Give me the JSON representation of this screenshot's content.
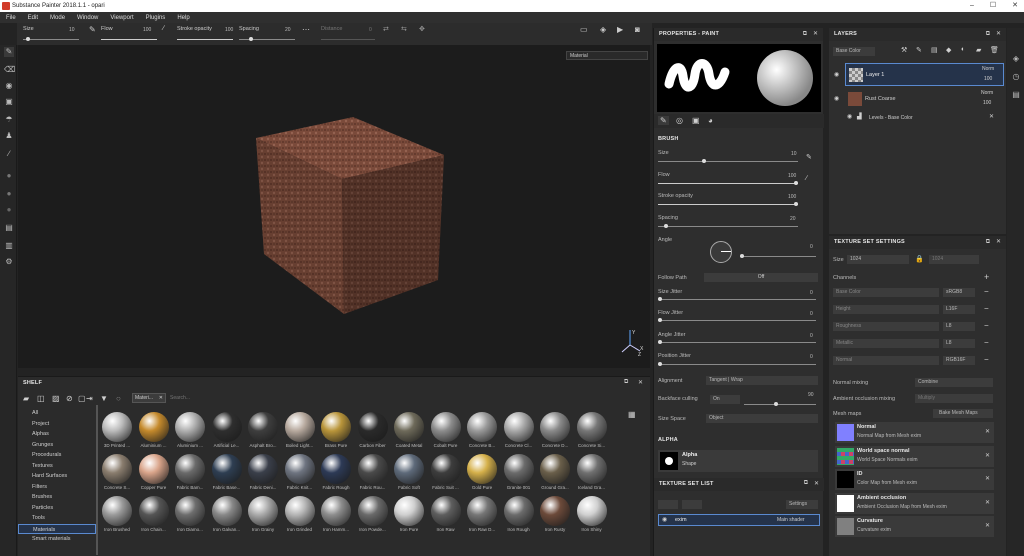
{
  "window": {
    "title": "Substance Painter 2018.1.1 - opari",
    "min": "–",
    "max": "☐",
    "close": "✕"
  },
  "menu": [
    "File",
    "Edit",
    "Mode",
    "Window",
    "Viewport",
    "Plugins",
    "Help"
  ],
  "toolbar": {
    "size_label": "Size",
    "size_val": "10",
    "flow_label": "Flow",
    "flow_val": "100",
    "stroke_label": "Stroke opacity",
    "stroke_val": "100",
    "spacing_label": "Spacing",
    "spacing_val": "20",
    "distance_label": "Distance",
    "distance_val": "0"
  },
  "viewport": {
    "mode_select": "Material",
    "axis_y": "Y",
    "axis_x": "X",
    "axis_z": "Z"
  },
  "shelf": {
    "title": "SHELF",
    "filter_chip": "Materi...",
    "search_placeholder": "Search...",
    "categories": [
      "All",
      "Project",
      "Alphas",
      "Grunges",
      "Procedurals",
      "Textures",
      "Hard Surfaces",
      "Filters",
      "Brushes",
      "Particles",
      "Tools",
      "Materials",
      "Smart materials"
    ],
    "selected_category": "Materials",
    "items_row1": [
      "3D Printed ...",
      "Aluminium ...",
      "Aluminium ...",
      "Artificial Le...",
      "Asphalt Bro...",
      "Boiled Light...",
      "Brass Pure",
      "Carbon Fiber",
      "Coated Metal",
      "Cobalt Pure",
      "Concrete B...",
      "Concrete Cl...",
      "Concrete D...",
      "Concrete Si..."
    ],
    "items_row2": [
      "Concrete S...",
      "Copper Pure",
      "Fabric Bam...",
      "Fabric Base...",
      "Fabric Deni...",
      "Fabric Knit...",
      "Fabric Rough",
      "Fabric Rou...",
      "Fabric Soft",
      "Fabric Suit ...",
      "Gold Pure",
      "Granite 001",
      "Ground Gra...",
      "Iceland Gra..."
    ],
    "items_row3": [
      "Iron Brushed",
      "Iron Chain...",
      "Iron Diamo...",
      "Iron Galvan...",
      "Iron Grainy",
      "Iron Grinded",
      "Iron Hamm...",
      "Iron Powde...",
      "Iron Pure",
      "Iron Raw",
      "Iron Raw D...",
      "Iron Rough",
      "Iron Rusty",
      "Iron Shiny"
    ]
  },
  "properties": {
    "title": "PROPERTIES - PAINT",
    "brush_header": "BRUSH",
    "size_label": "Size",
    "size_val": "10",
    "flow_label": "Flow",
    "flow_val": "100",
    "stroke_label": "Stroke opacity",
    "stroke_val": "100",
    "spacing_label": "Spacing",
    "spacing_val": "20",
    "angle_label": "Angle",
    "angle_val": "0",
    "follow_label": "Follow Path",
    "follow_val": "Off",
    "sizej_label": "Size Jitter",
    "sizej_val": "0",
    "flowj_label": "Flow Jitter",
    "flowj_val": "0",
    "anglej_label": "Angle Jitter",
    "anglej_val": "0",
    "posj_label": "Position Jitter",
    "posj_val": "0",
    "align_label": "Alignment",
    "align_val": "Tangent | Wrap",
    "backface_label": "Backface culling",
    "backface_val": "On",
    "backface_num": "90",
    "space_label": "Size Space",
    "space_val": "Object",
    "alpha_header": "ALPHA",
    "alpha_name": "Alpha",
    "alpha_sub": "Shape",
    "tsl_header": "TEXTURE SET LIST",
    "tsl_settings": "Settings",
    "tsl_item": "exim",
    "tsl_shader": "Main shader"
  },
  "layers": {
    "title": "LAYERS",
    "channel_select": "Base Color",
    "items": [
      {
        "name": "Layer 1",
        "blend": "Norm",
        "opacity": "100"
      },
      {
        "name": "Rust Coarse",
        "blend": "Norm",
        "opacity": "100"
      },
      {
        "name": "Levels - Base Color"
      }
    ]
  },
  "tss": {
    "title": "TEXTURE SET SETTINGS",
    "size_label": "Size",
    "size_val": "1024",
    "size_val2": "1024",
    "channels_label": "Channels",
    "channels": [
      {
        "name": "Base Color",
        "fmt": "sRGB8"
      },
      {
        "name": "Height",
        "fmt": "L16F"
      },
      {
        "name": "Roughness",
        "fmt": "L8"
      },
      {
        "name": "Metallic",
        "fmt": "L8"
      },
      {
        "name": "Normal",
        "fmt": "RGB16F"
      }
    ],
    "normal_mix_label": "Normal mixing",
    "normal_mix_val": "Combine",
    "ao_mix_label": "Ambient occlusion mixing",
    "ao_mix_val": "Multiply",
    "mesh_maps_label": "Mesh maps",
    "bake_button": "Bake Mesh Maps",
    "maps": [
      {
        "name": "Normal",
        "sub": "Normal Map from Mesh exim",
        "color": "#8080ff"
      },
      {
        "name": "World space normal",
        "sub": "World Space Normals exim",
        "color": "#6aa06a"
      },
      {
        "name": "ID",
        "sub": "Color Map from Mesh exim",
        "color": "#000000"
      },
      {
        "name": "Ambient occlusion",
        "sub": "Ambient Occlusion Map from Mesh exim",
        "color": "#ffffff"
      },
      {
        "name": "Curvature",
        "sub": "Curvature exim",
        "color": "#808080"
      }
    ]
  }
}
